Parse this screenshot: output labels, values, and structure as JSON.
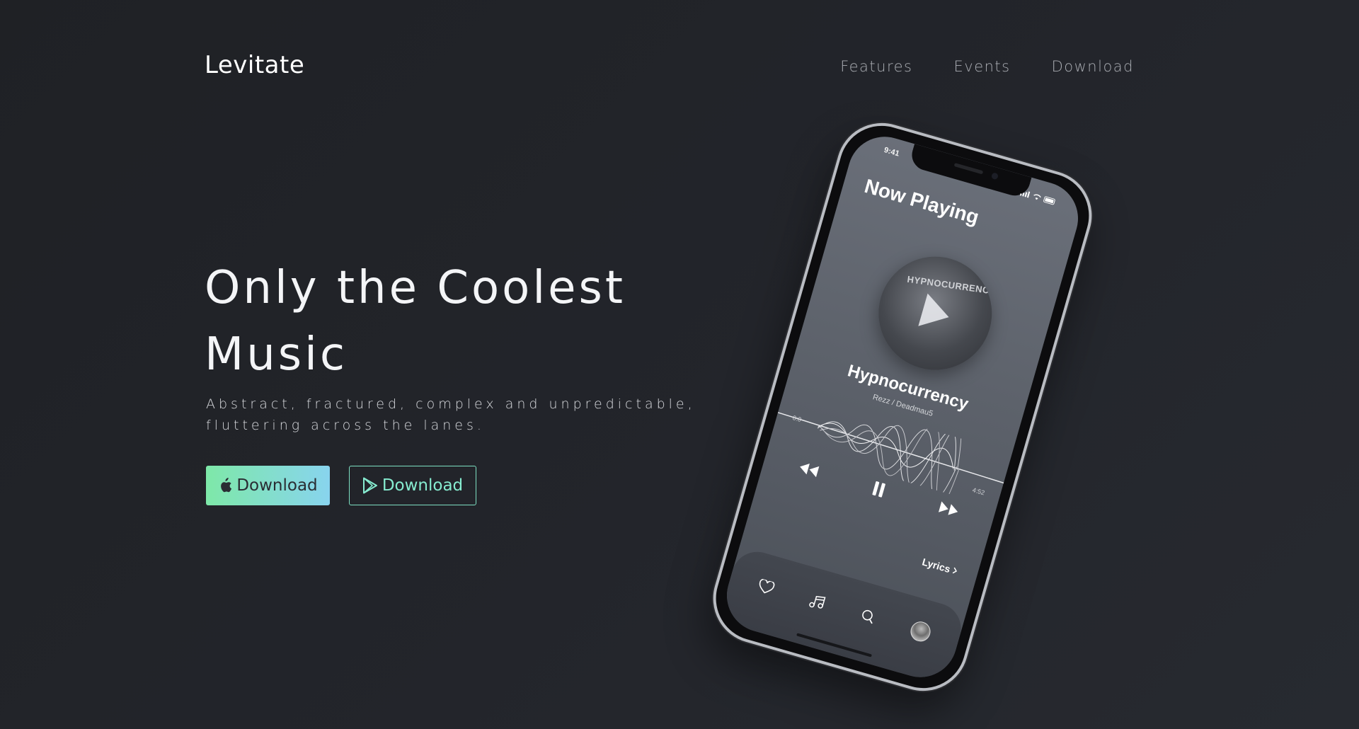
{
  "header": {
    "logo": "Levitate",
    "nav": [
      "Features",
      "Events",
      "Download"
    ]
  },
  "hero": {
    "title_line1": "Only the Coolest",
    "title_line2": "Music",
    "subtitle_line1": "Abstract, fractured, complex and unpredictable,",
    "subtitle_line2": "fluttering across the lanes.",
    "apple_button_label": "Download",
    "play_button_label": "Download"
  },
  "phone": {
    "status_time": "9:41",
    "heading": "Now Playing",
    "album_text": "HYPNOCURRENCY",
    "track_title": "Hypnocurrency",
    "track_artist": "Rezz / Deadmau5",
    "time_start": "0:0",
    "time_end": "4:52",
    "lyrics_label": "Lyrics",
    "tabs": [
      "heart-icon",
      "music-note-icon",
      "search-icon",
      "avatar"
    ]
  },
  "colors": {
    "accent_green": "#7ee8a8",
    "accent_blue": "#88d4ee",
    "outline_teal": "#7de0c2",
    "background": "#202227"
  }
}
